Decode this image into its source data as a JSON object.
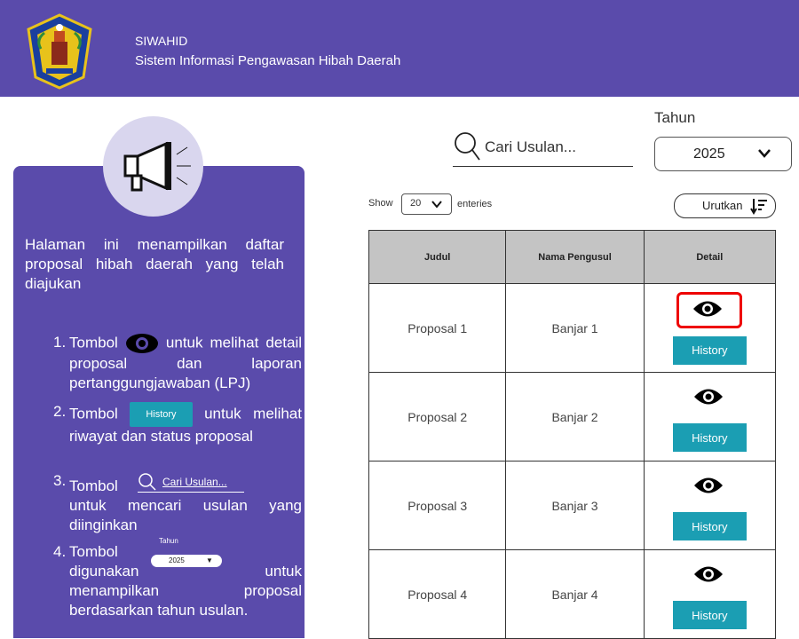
{
  "header": {
    "app_name": "SIWAHID",
    "app_subtitle": "Sistem Informasi Pengawasan Hibah Daerah",
    "brand_color": "#5a4bab"
  },
  "help_panel": {
    "intro": "Halaman ini menampilkan daftar proposal hibah daerah yang telah diajukan",
    "steps": [
      {
        "num": "1.",
        "prefix": "Tombol",
        "suffix": "untuk melihat detail proposal dan laporan pertanggungjawaban (LPJ)"
      },
      {
        "num": "2.",
        "prefix": "Tombol",
        "suffix": "untuk melihat riwayat dan status proposal"
      },
      {
        "num": "3.",
        "prefix": "Tombol",
        "suffix": "untuk mencari usulan yang diinginkan"
      },
      {
        "num": "4.",
        "prefix": "Tombol",
        "suffix": "digunakan",
        "suffix2": "untuk menampilkan proposal berdasarkan tahun usulan."
      }
    ],
    "mini_history": "History",
    "mini_search": "Cari Usulan...",
    "mini_tahun": "Tahun",
    "mini_year": "2025"
  },
  "search": {
    "placeholder": "Cari Usulan..."
  },
  "filter": {
    "label": "Tahun",
    "year": "2025"
  },
  "list_controls": {
    "show": "Show",
    "page_size": "20",
    "entries": "enteries",
    "sort_label": "Urutkan"
  },
  "table": {
    "headers": [
      "Judul",
      "Nama Pengusul",
      "Detail"
    ],
    "rows": [
      {
        "judul": "Proposal 1",
        "pengusul": "Banjar 1",
        "history": "History"
      },
      {
        "judul": "Proposal 2",
        "pengusul": "Banjar 2",
        "history": "History"
      },
      {
        "judul": "Proposal 3",
        "pengusul": "Banjar 3",
        "history": "History"
      },
      {
        "judul": "Proposal 4",
        "pengusul": "Banjar 4",
        "history": "History"
      }
    ]
  },
  "colors": {
    "accent": "#1b9eb3",
    "highlight": "#e00000"
  }
}
